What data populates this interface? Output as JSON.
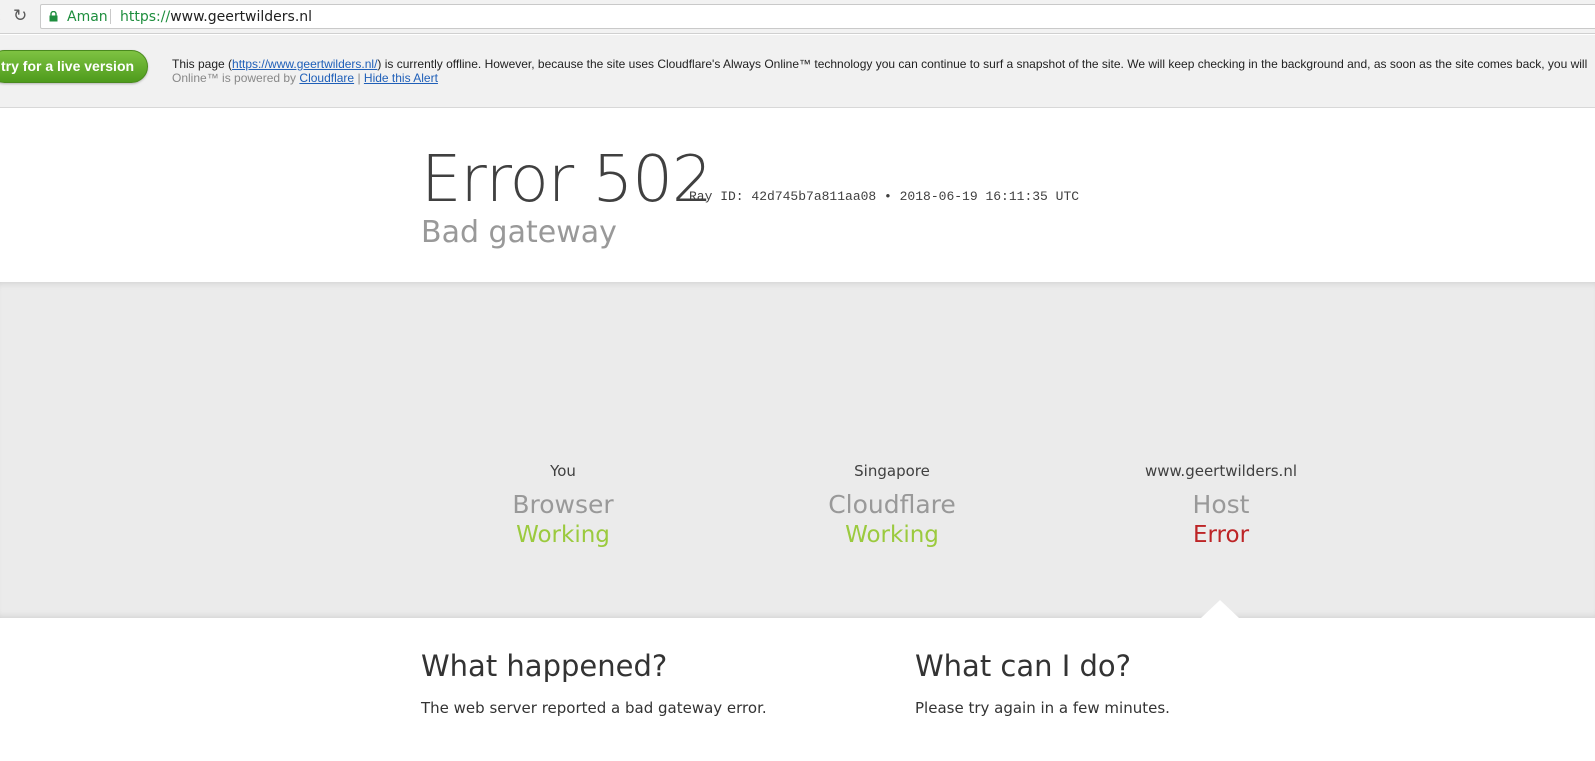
{
  "browser": {
    "secure_label": "Aman",
    "url_scheme": "https://",
    "url_host": "www.geertwilders.nl"
  },
  "alert": {
    "live_button": "try for a live version",
    "text_before_link": "This page (",
    "page_link": "https://www.geertwilders.nl/",
    "text_after_link": ") is currently offline. However, because the site uses Cloudflare's Always Online™ technology you can continue to surf a snapshot of the site. We will keep checking in the background and, as soon as the site comes back, you will",
    "line2_text": "Online™ is powered by ",
    "cloudflare_link": "Cloudflare",
    "separator": " | ",
    "hide_link": "Hide this Alert"
  },
  "header": {
    "error_code": "Error 502",
    "ray_id": "Ray ID: 42d745b7a811aa08 • 2018-06-19 16:11:35 UTC",
    "subtitle": "Bad gateway"
  },
  "nodes": [
    {
      "location": "You",
      "name": "Browser",
      "status": "Working"
    },
    {
      "location": "Singapore",
      "name": "Cloudflare",
      "status": "Working"
    },
    {
      "location": "www.geertwilders.nl",
      "name": "Host",
      "status": "Error"
    }
  ],
  "colors": {
    "working": "#9bca3e",
    "error": "#bd2426",
    "live_button": "#5aa824"
  },
  "what_happened": {
    "heading": "What happened?",
    "body": "The web server reported a bad gateway error."
  },
  "what_can_i_do": {
    "heading": "What can I do?",
    "body": "Please try again in a few minutes."
  }
}
